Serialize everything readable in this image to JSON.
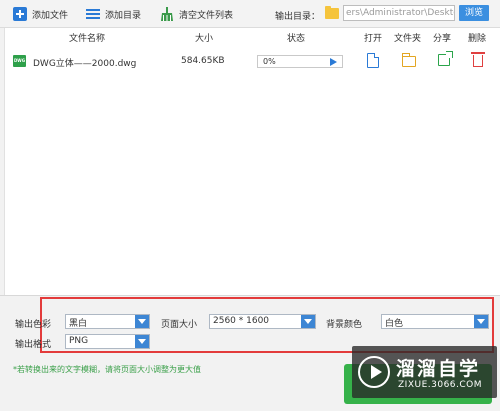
{
  "toolbar": {
    "add_file": "添加文件",
    "add_dir": "添加目录",
    "clear_list": "清空文件列表",
    "output_dir_label": "输出目录：",
    "output_path": "ers\\Administrator\\Desktop",
    "browse": "浏览"
  },
  "columns": {
    "name": "文件名称",
    "size": "大小",
    "status": "状态",
    "open": "打开",
    "folder": "文件夹",
    "share": "分享",
    "delete": "删除"
  },
  "files": [
    {
      "icon_text": "DWG",
      "name": "DWG立体——2000.dwg",
      "size": "584.65KB",
      "progress_text": "0%",
      "progress": 0
    }
  ],
  "settings": {
    "color_label": "输出色彩",
    "color_value": "黑白",
    "page_size_label": "页面大小",
    "page_size_value": "2560 * 1600",
    "bg_color_label": "背景颜色",
    "bg_color_value": "白色",
    "format_label": "输出格式",
    "format_value": "PNG"
  },
  "tip": "*若转换出来的文字模糊，请将页面大小调整为更大值",
  "watermark": {
    "title": "溜溜自学",
    "url": "ZIXUE.3066.COM"
  },
  "colors": {
    "accent_blue": "#3b8fe0",
    "highlight_red": "#e33b3b",
    "start_green": "#36b24a"
  }
}
